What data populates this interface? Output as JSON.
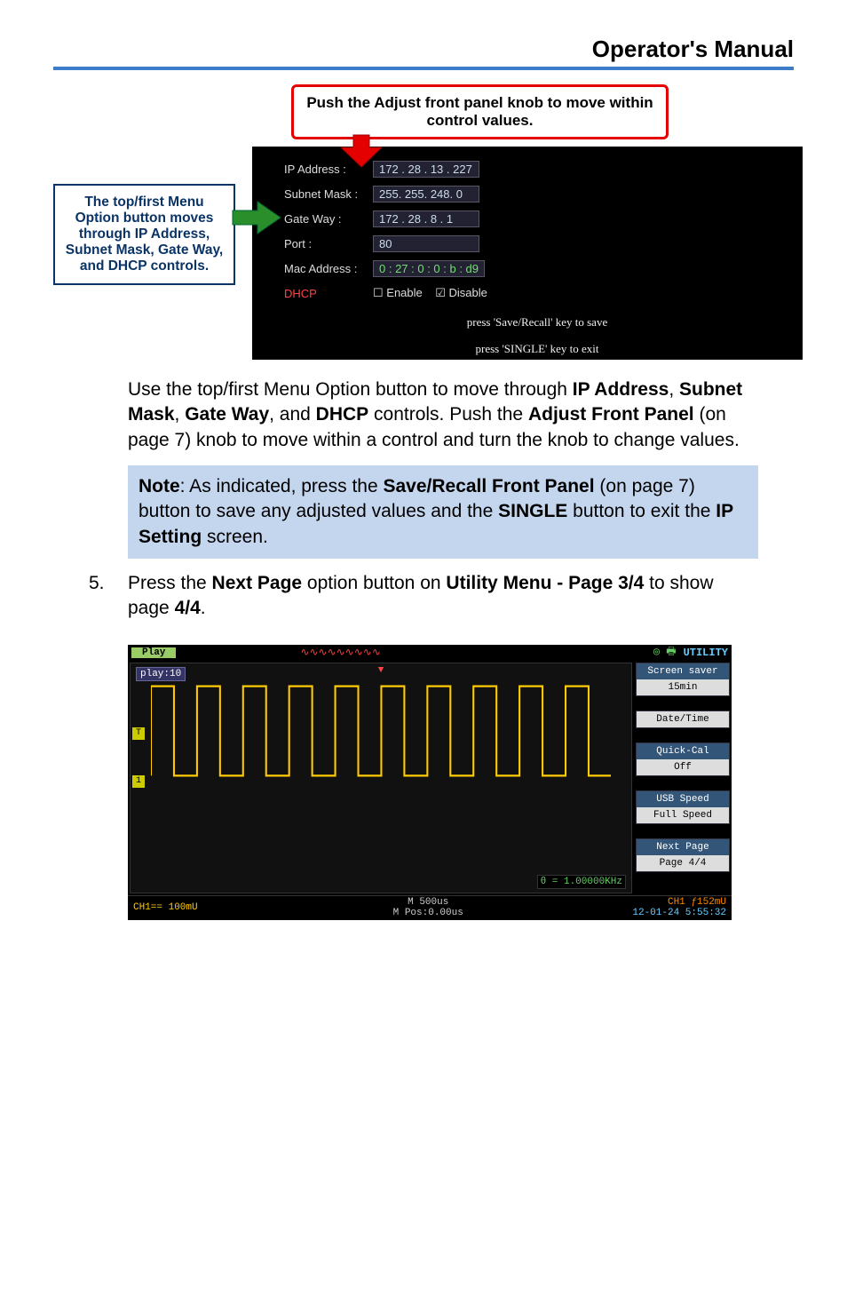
{
  "header": {
    "title": "Operator's Manual"
  },
  "callout_top": "Push the Adjust front panel knob to move within control values.",
  "callout_left": {
    "l1": "The top/first Menu Option button moves through IP Address, Subnet Mask, Gate Way, and DHCP controls."
  },
  "ip": {
    "rows": [
      {
        "label": "IP Address :",
        "value": "172 . 28 . 13 . 227"
      },
      {
        "label": "Subnet Mask :",
        "value": "255. 255. 248.  0"
      },
      {
        "label": "Gate Way :",
        "value": "172 . 28 .  8  .  1"
      },
      {
        "label": "Port :",
        "value": "80"
      },
      {
        "label": "Mac Address :",
        "value": "0 : 27 : 0 : 0 : b : d9"
      }
    ],
    "dhcp_label": "DHCP",
    "dhcp_enable": "Enable",
    "dhcp_disable": "Disable",
    "footer1": "press 'Save/Recall' key to save",
    "footer2": "press 'SINGLE' key to exit"
  },
  "para1": {
    "pre": "Use the top/first Menu Option button to move through ",
    "b1": "IP Address",
    "c1": ", ",
    "b2": "Subnet Mask",
    "c2": ", ",
    "b3": "Gate Way",
    "c3": ", and ",
    "b4": "DHCP",
    "c4": " controls. Push the ",
    "b5": "Adjust Front Panel",
    "c5": " (on page 7) knob to move within a control and turn the knob to change values."
  },
  "note": {
    "b0": "Note",
    "t1": ": As indicated, press the ",
    "b1": "Save/Recall Front Panel",
    "t2": " (on page 7) button to save any adjusted values and the ",
    "b2": "SINGLE",
    "t3": " button to exit the ",
    "b3": "IP Setting",
    "t4": " screen."
  },
  "step5": {
    "num": "5.",
    "t1": "Press the ",
    "b1": "Next Page",
    "t2": " option button on ",
    "b2": "Utility Menu - Page 3/4",
    "t3": " to show page ",
    "b3": "4/4",
    "t4": "."
  },
  "scope": {
    "play_btn": "Play",
    "utility": "UTILITY",
    "play_label": "play:10",
    "freq": "θ = 1.00000KHz",
    "menu": [
      {
        "label": "Screen saver",
        "value": "15min"
      },
      {
        "label": "Date/Time",
        "value": ""
      },
      {
        "label": "Quick-Cal",
        "value": "Off"
      },
      {
        "label": "USB Speed",
        "value": "Full Speed"
      },
      {
        "label": "Next Page",
        "value": "Page 4/4"
      }
    ],
    "ch1": "CH1== 100mU",
    "mpos_a": "M 500us",
    "mpos_b": "M Pos:0.00us",
    "trig_a": "CH1 ƒ152mU",
    "trig_b": "12-01-24 5:55:32"
  }
}
